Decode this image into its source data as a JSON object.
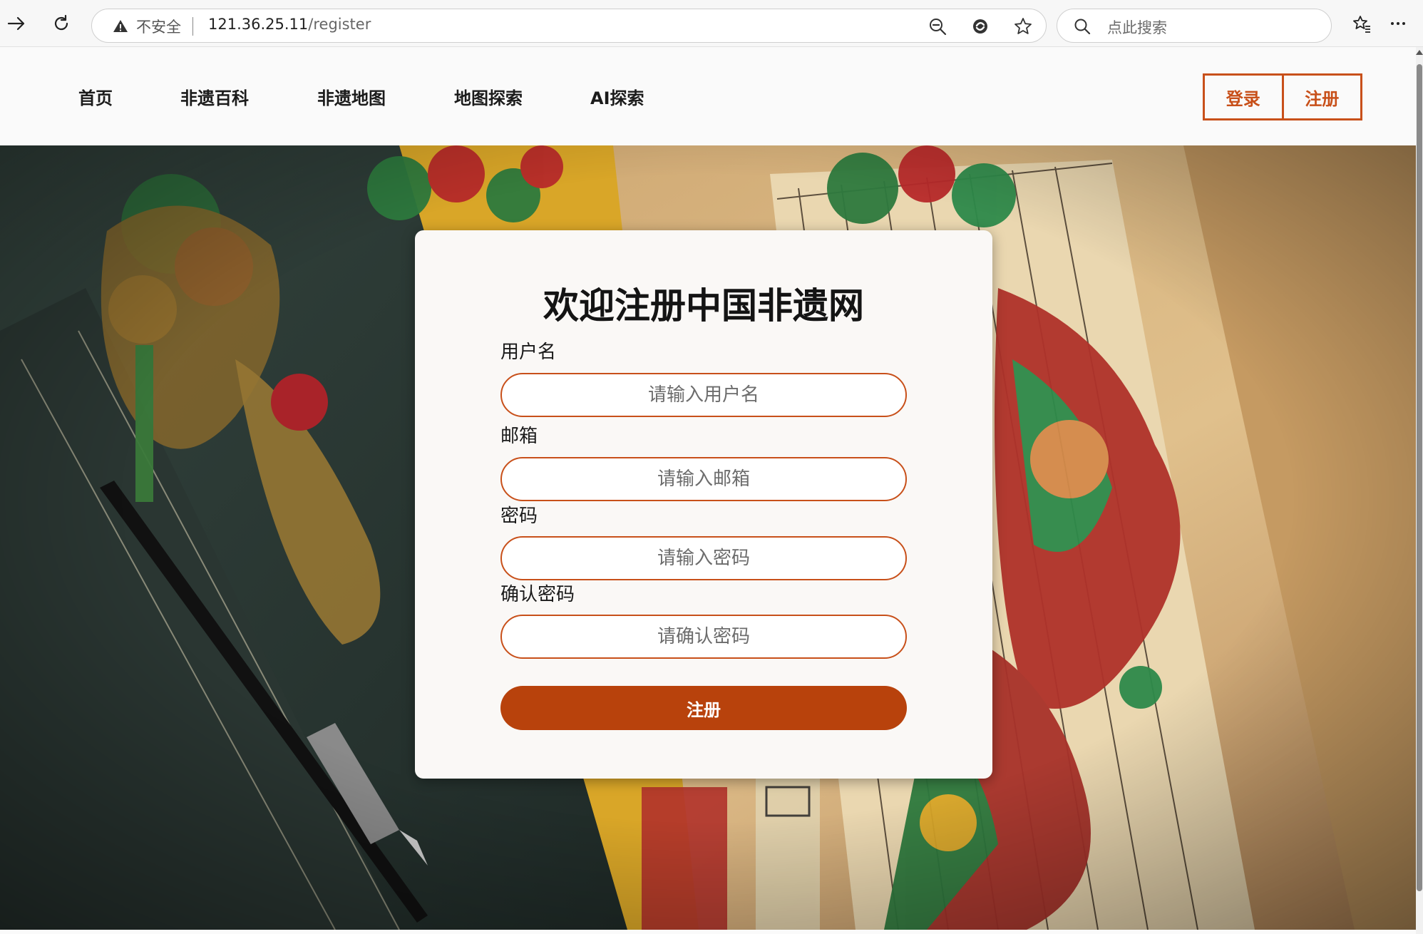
{
  "browser": {
    "security_label": "不安全",
    "url_host": "121.36.25.11",
    "url_path": "/register",
    "search_placeholder": "点此搜索"
  },
  "nav": {
    "items": [
      "首页",
      "非遗百科",
      "非遗地图",
      "地图探索",
      "AI探索"
    ],
    "login_label": "登录",
    "register_label": "注册"
  },
  "form": {
    "title": "欢迎注册中国非遗网",
    "username_label": "用户名",
    "username_placeholder": "请输入用户名",
    "email_label": "邮箱",
    "email_placeholder": "请输入邮箱",
    "password_label": "密码",
    "password_placeholder": "请输入密码",
    "confirm_label": "确认密码",
    "confirm_placeholder": "请确认密码",
    "submit_label": "注册"
  },
  "colors": {
    "accent": "#c8501a",
    "submit": "#b8420c"
  }
}
